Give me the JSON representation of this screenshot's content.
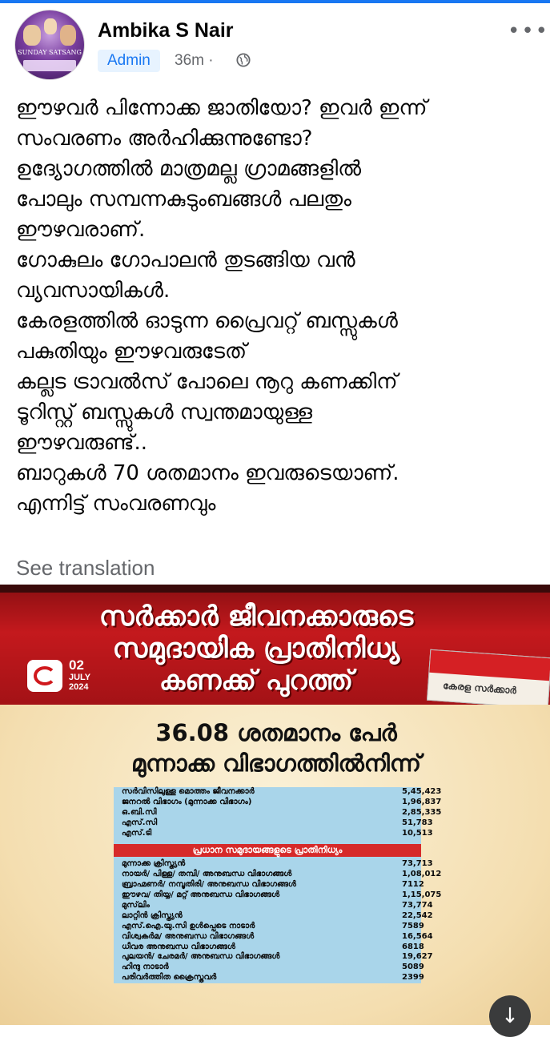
{
  "header": {
    "name": "Ambika S Nair",
    "role_badge": "Admin",
    "time": "36m",
    "separator": "·",
    "privacy_icon": "globe-icon",
    "more_icon": "more-dots-icon",
    "avatar_text": "SUNDAY SATSANG"
  },
  "post": {
    "lines": [
      "ഈഴവർ പിന്നോക്ക ജാതിയോ? ഇവർ ഇന്ന്",
      "സംവരണം അർഹിക്കുന്നുണ്ടോ?",
      "ഉദ്യോഗത്തിൽ മാത്രമല്ല ഗ്രാമങ്ങളിൽ",
      "പോലും സമ്പന്നകുടുംബങ്ങൾ പലതും",
      "ഈഴവരാണ്.",
      "ഗോകുലം ഗോപാലൻ തുടങ്ങിയ വൻ",
      "വ്യവസായികൾ.",
      "കേരളത്തിൽ ഓടുന്ന പ്രൈവറ്റ് ബസ്സുകൾ",
      "പകുതിയും ഈഴവരുടേത്",
      "കല്ലട ട്രാവൽസ് പോലെ നൂറു കണക്കിന്",
      "ടൂറിസ്റ്റ് ബസ്സുകൾ സ്വന്തമായുള്ള",
      "ഈഴവരുണ്ട്..",
      "ബാറുകൾ 70 ശതമാനം ഇവരുടെയാണ്.",
      "എന്നിട്ട് സംവരണവും"
    ],
    "see_translation": "See translation"
  },
  "image": {
    "banner_title": [
      "സർക്കാർ ജീവനക്കാരുടെ",
      "സമുദായിക പ്രാതിനിധ്യ",
      "കണക്ക് പുറത്ത്"
    ],
    "date_day": "02",
    "date_month": "JULY",
    "date_year": "2024",
    "paper_label": "കേരള സർക്കാർ",
    "headline": [
      "36.08 ശതമാനം പേർ",
      "മുന്നാക്ക വിഭാഗത്തിൽനിന്ന്"
    ],
    "summary_rows": [
      {
        "label": "സർവിസിലുള്ള മൊത്തം ജീവനക്കാർ",
        "value": "5,45,423"
      },
      {
        "label": "ജനറൽ വിഭാഗം (മുന്നാക്ക വിഭാഗം)",
        "value": "1,96,837"
      },
      {
        "label": "ഒ.ബി.സി",
        "value": "2,85,335"
      },
      {
        "label": "എസ്.സി",
        "value": "51,783"
      },
      {
        "label": "എസ്.ടി",
        "value": "10,513"
      }
    ],
    "section_title": "പ്രധാന സമുദായങ്ങളുടെ പ്രാതിനിധ്യം",
    "community_rows": [
      {
        "label": "മുന്നാക്ക ക്രിസ്ത്യൻ",
        "value": "73,713"
      },
      {
        "label": "നായർ/ പിള്ള/ തമ്പി/ അനുബന്ധ വിഭാഗങ്ങൾ",
        "value": "1,08,012"
      },
      {
        "label": "ബ്രാഹ്മണർ/ നമ്പൂതിരി/ അനുബന്ധ വിഭാഗങ്ങൾ",
        "value": "7112"
      },
      {
        "label": "ഈഴവ/ തിയ്യ/ മറ്റ് അനുബന്ധ വിഭാഗങ്ങൾ",
        "value": "1,15,075"
      },
      {
        "label": "മുസ്‌ലിം",
        "value": "73,774"
      },
      {
        "label": "ലാറ്റിൻ ക്രിസ്ത്യൻ",
        "value": "22,542"
      },
      {
        "label": "എസ്.ഐ.യു.സി ഉൾപ്പെടെ നാടാർ",
        "value": "7589"
      },
      {
        "label": "വിശ്വകർമ/ അനുബന്ധ വിഭാഗങ്ങൾ",
        "value": "16,564"
      },
      {
        "label": "ധീവര അനുബന്ധ വിഭാഗങ്ങൾ",
        "value": "6818"
      },
      {
        "label": "പുലയൻ/ ചേരമർ/ അനുബന്ധ വിഭാഗങ്ങൾ",
        "value": "19,627"
      },
      {
        "label": "ഹിന്ദു നാടാർ",
        "value": "5089"
      },
      {
        "label": "പരിവർത്തിത ക്രൈസ്തവർ",
        "value": "2399"
      }
    ]
  },
  "fab": {
    "icon": "arrow-down-icon",
    "glyph": "↓"
  }
}
